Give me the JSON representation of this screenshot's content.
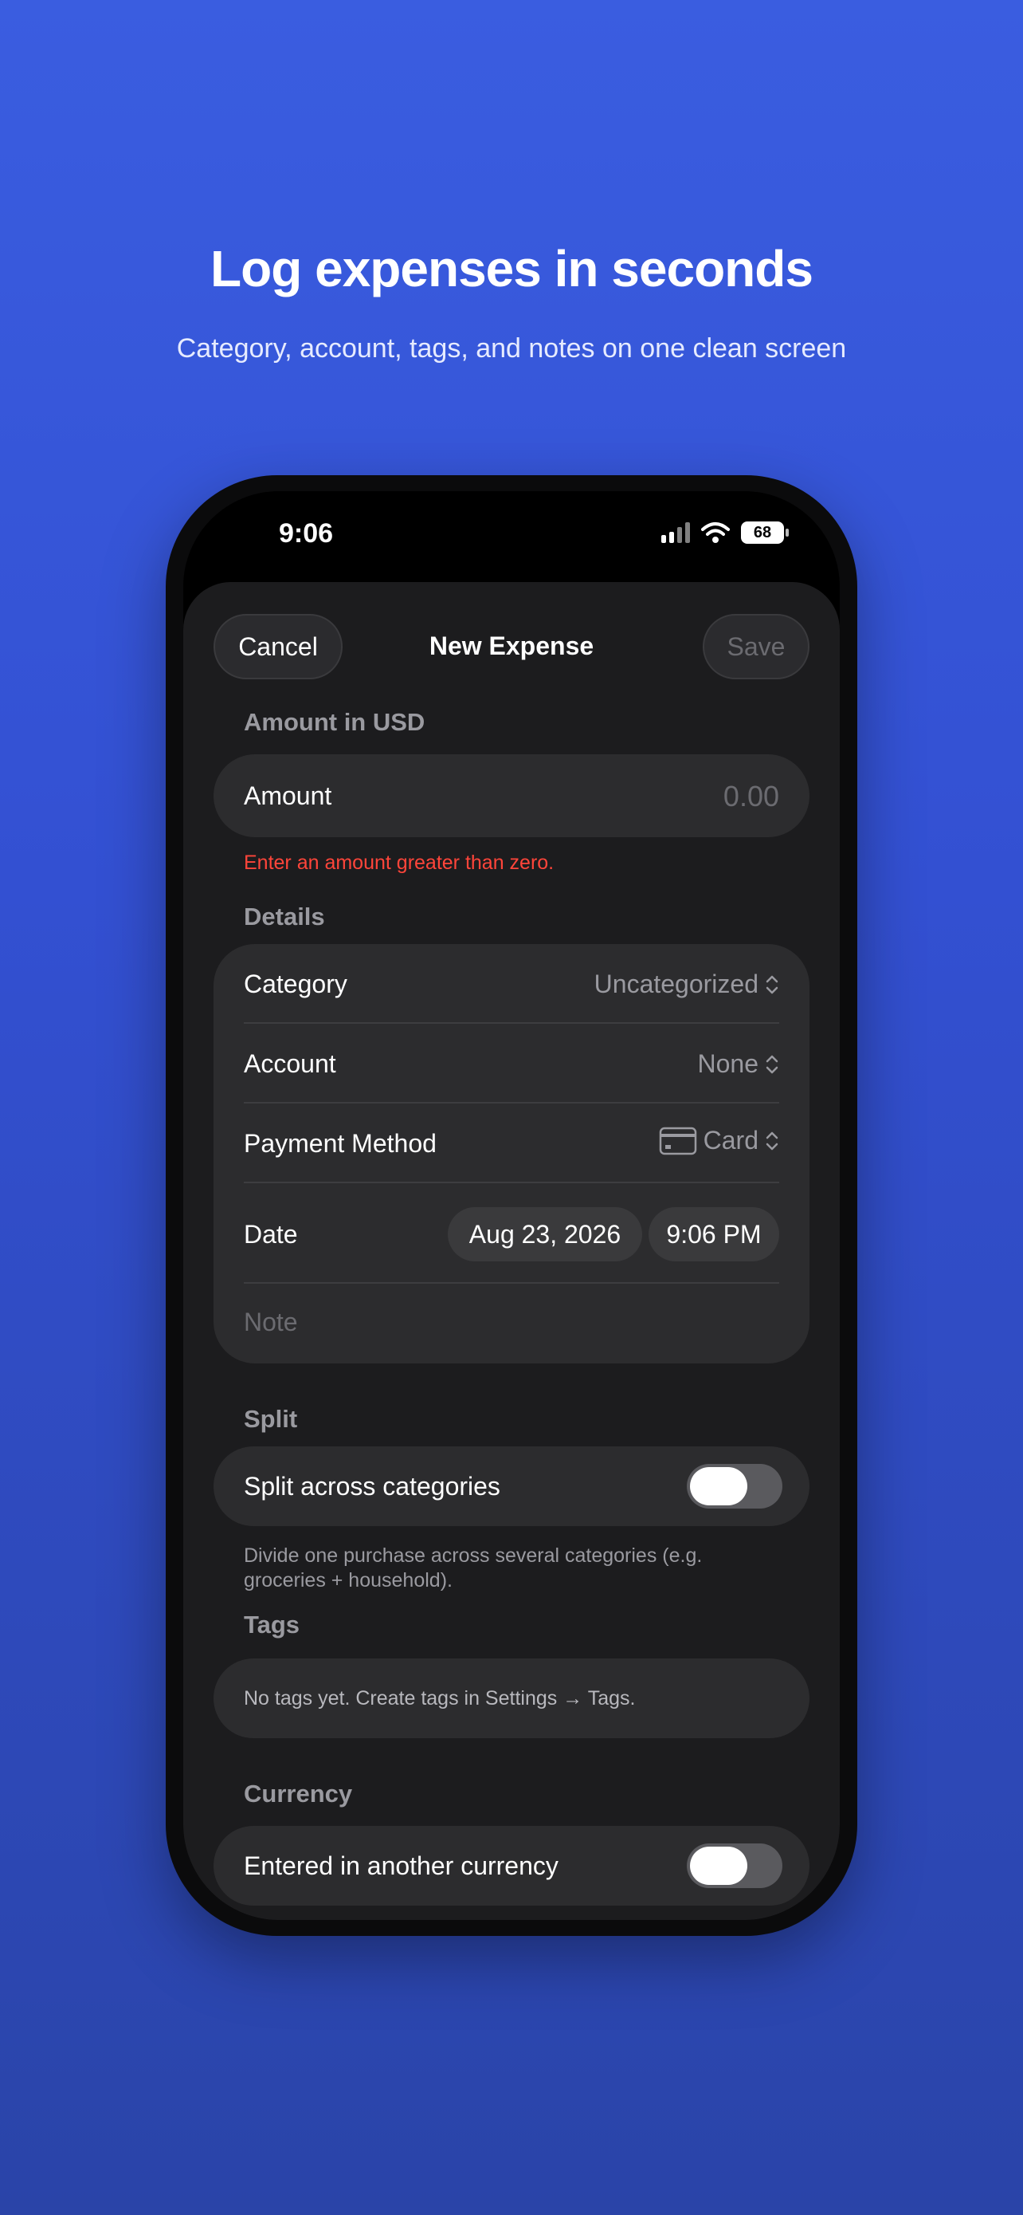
{
  "promo": {
    "headline": "Log expenses in seconds",
    "subheadline": "Category, account, tags, and notes on one clean screen"
  },
  "status_bar": {
    "time": "9:06",
    "battery": "68",
    "icons": [
      "signal-icon",
      "wifi-icon",
      "battery-icon"
    ]
  },
  "nav": {
    "cancel": "Cancel",
    "title": "New Expense",
    "save": "Save"
  },
  "amount": {
    "section": "Amount in USD",
    "label": "Amount",
    "placeholder": "0.00",
    "error": "Enter an amount greater than zero."
  },
  "details": {
    "section": "Details",
    "category_label": "Category",
    "category_value": "Uncategorized",
    "account_label": "Account",
    "account_value": "None",
    "payment_label": "Payment Method",
    "payment_value": "Card",
    "date_label": "Date",
    "date_value": "Aug 23, 2026",
    "time_value": "9:06 PM",
    "note_placeholder": "Note"
  },
  "split": {
    "section": "Split",
    "label": "Split across categories",
    "enabled": false,
    "footnote": "Divide one purchase across several categories (e.g. groceries + household)."
  },
  "tags": {
    "section": "Tags",
    "empty": "No tags yet. Create tags in Settings → Tags."
  },
  "currency": {
    "section": "Currency",
    "label": "Entered in another currency",
    "enabled": false
  },
  "colors": {
    "background": "#3350d2",
    "sheet": "#1c1c1e",
    "card": "#2c2c2e",
    "error": "#ff453a"
  }
}
